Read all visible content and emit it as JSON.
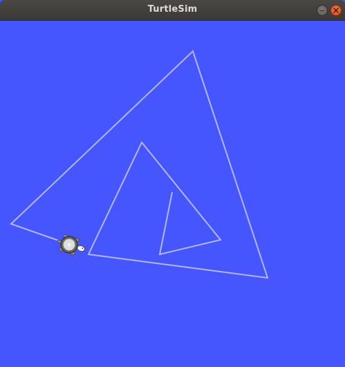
{
  "window": {
    "title": "TurtleSim",
    "background_color": "#4556ff",
    "pen_color": "#b3b8ff"
  },
  "controls": {
    "minimize_icon": "minimize-icon",
    "close_icon": "close-icon"
  },
  "turtle": {
    "icon": "turtle-icon",
    "heading": "east-southeast"
  }
}
